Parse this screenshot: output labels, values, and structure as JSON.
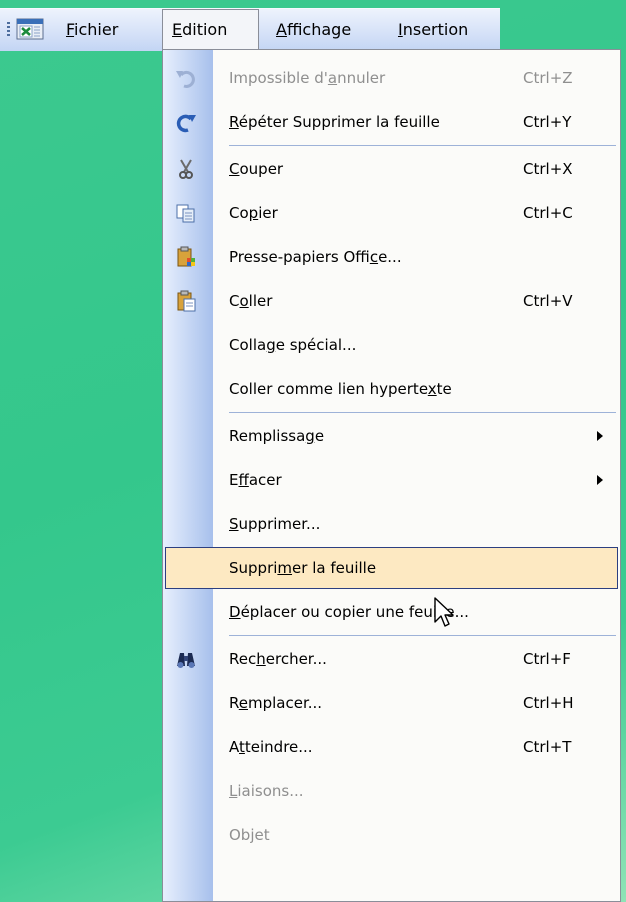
{
  "menubar": {
    "items": [
      {
        "label": "Fichier",
        "accel": "F",
        "rest": "ichier"
      },
      {
        "label": "Edition",
        "accel": "E",
        "rest": "dition"
      },
      {
        "label": "Affichage",
        "accel": "A",
        "rest": "ffichage"
      },
      {
        "label": "Insertion",
        "accel": "I",
        "rest": "nsertion"
      }
    ]
  },
  "edit_menu": {
    "items": [
      {
        "pre": "Impossible d'",
        "u": "a",
        "post": "nnuler",
        "shortcut": "Ctrl+Z",
        "icon": "undo-icon",
        "disabled": true
      },
      {
        "pre": "",
        "u": "R",
        "post": "épéter Supprimer la feuille",
        "shortcut": "Ctrl+Y",
        "icon": "redo-icon"
      },
      {
        "pre": "",
        "u": "C",
        "post": "ouper",
        "shortcut": "Ctrl+X",
        "icon": "scissors-icon"
      },
      {
        "pre": "Co",
        "u": "p",
        "post": "ier",
        "shortcut": "Ctrl+C",
        "icon": "copy-icon"
      },
      {
        "pre": "Presse-papiers Offi",
        "u": "c",
        "post": "e...",
        "shortcut": "",
        "icon": "clipboard-office-icon"
      },
      {
        "pre": "C",
        "u": "o",
        "post": "ller",
        "shortcut": "Ctrl+V",
        "icon": "paste-icon"
      },
      {
        "pre": "Colla",
        "u": "g",
        "post": "e spécial...",
        "shortcut": ""
      },
      {
        "pre": "Coller comme lien hyperte",
        "u": "x",
        "post": "te",
        "shortcut": ""
      },
      {
        "pre": "Remplissa",
        "u": "g",
        "post": "e",
        "shortcut": "",
        "submenu": true
      },
      {
        "pre": "E",
        "u": "f",
        "post": "facer",
        "shortcut": "",
        "submenu": true
      },
      {
        "pre": "",
        "u": "S",
        "post": "upprimer...",
        "shortcut": ""
      },
      {
        "pre": "Suppri",
        "u": "m",
        "post": "er la feuille",
        "shortcut": "",
        "highlighted": true
      },
      {
        "pre": "",
        "u": "D",
        "post": "éplacer ou copier une feuille...",
        "shortcut": ""
      },
      {
        "pre": "Rec",
        "u": "h",
        "post": "ercher...",
        "shortcut": "Ctrl+F",
        "icon": "binoculars-icon"
      },
      {
        "pre": "R",
        "u": "e",
        "post": "mplacer...",
        "shortcut": "Ctrl+H"
      },
      {
        "pre": "A",
        "u": "t",
        "post": "teindre...",
        "shortcut": "Ctrl+T"
      },
      {
        "pre": "",
        "u": "L",
        "post": "iaisons...",
        "shortcut": "",
        "disabled": true
      },
      {
        "pre": "Ob",
        "u": "j",
        "post": "et",
        "shortcut": "",
        "disabled": true
      }
    ]
  },
  "colors": {
    "highlight": "#fde9c2",
    "highlight_border": "#2c3f80",
    "gutter": "#a7c0ec"
  }
}
